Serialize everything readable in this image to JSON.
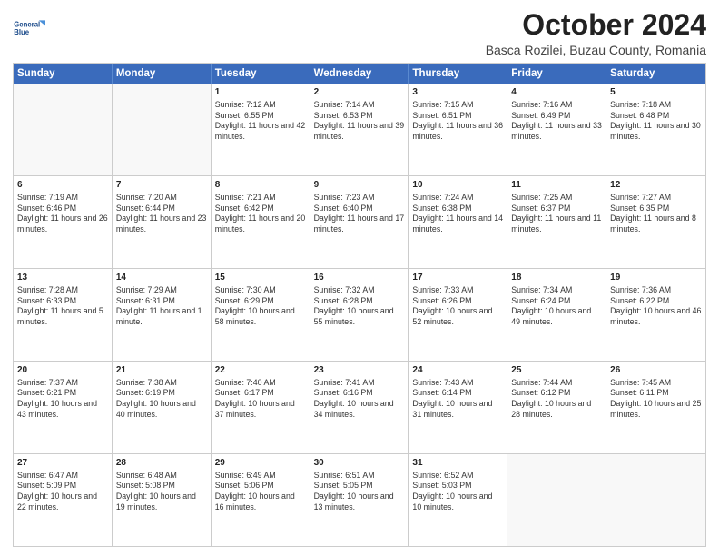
{
  "header": {
    "logo_line1": "General",
    "logo_line2": "Blue",
    "month_title": "October 2024",
    "location": "Basca Rozilei, Buzau County, Romania"
  },
  "days_of_week": [
    "Sunday",
    "Monday",
    "Tuesday",
    "Wednesday",
    "Thursday",
    "Friday",
    "Saturday"
  ],
  "weeks": [
    [
      {
        "day": "",
        "sunrise": "",
        "sunset": "",
        "daylight": ""
      },
      {
        "day": "",
        "sunrise": "",
        "sunset": "",
        "daylight": ""
      },
      {
        "day": "1",
        "sunrise": "Sunrise: 7:12 AM",
        "sunset": "Sunset: 6:55 PM",
        "daylight": "Daylight: 11 hours and 42 minutes."
      },
      {
        "day": "2",
        "sunrise": "Sunrise: 7:14 AM",
        "sunset": "Sunset: 6:53 PM",
        "daylight": "Daylight: 11 hours and 39 minutes."
      },
      {
        "day": "3",
        "sunrise": "Sunrise: 7:15 AM",
        "sunset": "Sunset: 6:51 PM",
        "daylight": "Daylight: 11 hours and 36 minutes."
      },
      {
        "day": "4",
        "sunrise": "Sunrise: 7:16 AM",
        "sunset": "Sunset: 6:49 PM",
        "daylight": "Daylight: 11 hours and 33 minutes."
      },
      {
        "day": "5",
        "sunrise": "Sunrise: 7:18 AM",
        "sunset": "Sunset: 6:48 PM",
        "daylight": "Daylight: 11 hours and 30 minutes."
      }
    ],
    [
      {
        "day": "6",
        "sunrise": "Sunrise: 7:19 AM",
        "sunset": "Sunset: 6:46 PM",
        "daylight": "Daylight: 11 hours and 26 minutes."
      },
      {
        "day": "7",
        "sunrise": "Sunrise: 7:20 AM",
        "sunset": "Sunset: 6:44 PM",
        "daylight": "Daylight: 11 hours and 23 minutes."
      },
      {
        "day": "8",
        "sunrise": "Sunrise: 7:21 AM",
        "sunset": "Sunset: 6:42 PM",
        "daylight": "Daylight: 11 hours and 20 minutes."
      },
      {
        "day": "9",
        "sunrise": "Sunrise: 7:23 AM",
        "sunset": "Sunset: 6:40 PM",
        "daylight": "Daylight: 11 hours and 17 minutes."
      },
      {
        "day": "10",
        "sunrise": "Sunrise: 7:24 AM",
        "sunset": "Sunset: 6:38 PM",
        "daylight": "Daylight: 11 hours and 14 minutes."
      },
      {
        "day": "11",
        "sunrise": "Sunrise: 7:25 AM",
        "sunset": "Sunset: 6:37 PM",
        "daylight": "Daylight: 11 hours and 11 minutes."
      },
      {
        "day": "12",
        "sunrise": "Sunrise: 7:27 AM",
        "sunset": "Sunset: 6:35 PM",
        "daylight": "Daylight: 11 hours and 8 minutes."
      }
    ],
    [
      {
        "day": "13",
        "sunrise": "Sunrise: 7:28 AM",
        "sunset": "Sunset: 6:33 PM",
        "daylight": "Daylight: 11 hours and 5 minutes."
      },
      {
        "day": "14",
        "sunrise": "Sunrise: 7:29 AM",
        "sunset": "Sunset: 6:31 PM",
        "daylight": "Daylight: 11 hours and 1 minute."
      },
      {
        "day": "15",
        "sunrise": "Sunrise: 7:30 AM",
        "sunset": "Sunset: 6:29 PM",
        "daylight": "Daylight: 10 hours and 58 minutes."
      },
      {
        "day": "16",
        "sunrise": "Sunrise: 7:32 AM",
        "sunset": "Sunset: 6:28 PM",
        "daylight": "Daylight: 10 hours and 55 minutes."
      },
      {
        "day": "17",
        "sunrise": "Sunrise: 7:33 AM",
        "sunset": "Sunset: 6:26 PM",
        "daylight": "Daylight: 10 hours and 52 minutes."
      },
      {
        "day": "18",
        "sunrise": "Sunrise: 7:34 AM",
        "sunset": "Sunset: 6:24 PM",
        "daylight": "Daylight: 10 hours and 49 minutes."
      },
      {
        "day": "19",
        "sunrise": "Sunrise: 7:36 AM",
        "sunset": "Sunset: 6:22 PM",
        "daylight": "Daylight: 10 hours and 46 minutes."
      }
    ],
    [
      {
        "day": "20",
        "sunrise": "Sunrise: 7:37 AM",
        "sunset": "Sunset: 6:21 PM",
        "daylight": "Daylight: 10 hours and 43 minutes."
      },
      {
        "day": "21",
        "sunrise": "Sunrise: 7:38 AM",
        "sunset": "Sunset: 6:19 PM",
        "daylight": "Daylight: 10 hours and 40 minutes."
      },
      {
        "day": "22",
        "sunrise": "Sunrise: 7:40 AM",
        "sunset": "Sunset: 6:17 PM",
        "daylight": "Daylight: 10 hours and 37 minutes."
      },
      {
        "day": "23",
        "sunrise": "Sunrise: 7:41 AM",
        "sunset": "Sunset: 6:16 PM",
        "daylight": "Daylight: 10 hours and 34 minutes."
      },
      {
        "day": "24",
        "sunrise": "Sunrise: 7:43 AM",
        "sunset": "Sunset: 6:14 PM",
        "daylight": "Daylight: 10 hours and 31 minutes."
      },
      {
        "day": "25",
        "sunrise": "Sunrise: 7:44 AM",
        "sunset": "Sunset: 6:12 PM",
        "daylight": "Daylight: 10 hours and 28 minutes."
      },
      {
        "day": "26",
        "sunrise": "Sunrise: 7:45 AM",
        "sunset": "Sunset: 6:11 PM",
        "daylight": "Daylight: 10 hours and 25 minutes."
      }
    ],
    [
      {
        "day": "27",
        "sunrise": "Sunrise: 6:47 AM",
        "sunset": "Sunset: 5:09 PM",
        "daylight": "Daylight: 10 hours and 22 minutes."
      },
      {
        "day": "28",
        "sunrise": "Sunrise: 6:48 AM",
        "sunset": "Sunset: 5:08 PM",
        "daylight": "Daylight: 10 hours and 19 minutes."
      },
      {
        "day": "29",
        "sunrise": "Sunrise: 6:49 AM",
        "sunset": "Sunset: 5:06 PM",
        "daylight": "Daylight: 10 hours and 16 minutes."
      },
      {
        "day": "30",
        "sunrise": "Sunrise: 6:51 AM",
        "sunset": "Sunset: 5:05 PM",
        "daylight": "Daylight: 10 hours and 13 minutes."
      },
      {
        "day": "31",
        "sunrise": "Sunrise: 6:52 AM",
        "sunset": "Sunset: 5:03 PM",
        "daylight": "Daylight: 10 hours and 10 minutes."
      },
      {
        "day": "",
        "sunrise": "",
        "sunset": "",
        "daylight": ""
      },
      {
        "day": "",
        "sunrise": "",
        "sunset": "",
        "daylight": ""
      }
    ]
  ]
}
